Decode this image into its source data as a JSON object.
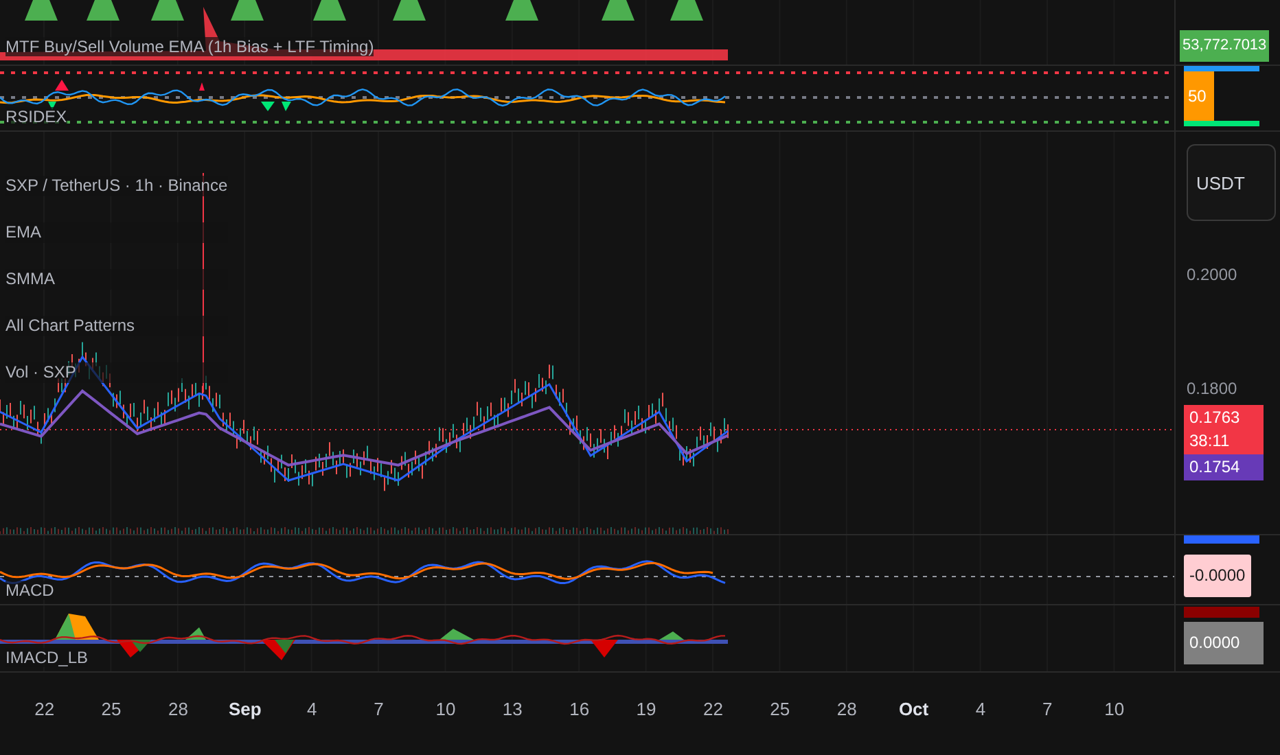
{
  "panes": [
    {
      "kind": "volume",
      "label": "MTF Buy/Sell Volume EMA (1h Bias + LTF Timing)",
      "tags": [
        {
          "text": "53,772.7013",
          "color": "#4caf50"
        }
      ]
    },
    {
      "kind": "rsi",
      "label": "RSIDEX",
      "tags": [
        {
          "text": "50",
          "color": "#ff9800"
        }
      ]
    },
    {
      "kind": "price",
      "legend": [
        "SXP / TetherUS · 1h · Binance",
        "EMA",
        "SMMA",
        "All Chart Patterns",
        "Vol · SXP"
      ],
      "currency_button": "USDT",
      "ticks": [
        "0.2000",
        "0.1800"
      ],
      "tags": [
        {
          "text": "0.1763",
          "sub": "38:11",
          "color": "#f23645"
        },
        {
          "text": "0.1754",
          "color": "#673ab7"
        }
      ]
    },
    {
      "kind": "macd",
      "label": "MACD",
      "tags": [
        {
          "text": "-0.0000",
          "color": "#ffcdd2"
        }
      ]
    },
    {
      "kind": "imacd",
      "label": "IMACD_LB",
      "tags": [
        {
          "text": "0.0000",
          "color": "#808080"
        }
      ]
    }
  ],
  "time_axis": [
    {
      "label": "22",
      "kind": "day"
    },
    {
      "label": "25",
      "kind": "day"
    },
    {
      "label": "28",
      "kind": "day"
    },
    {
      "label": "Sep",
      "kind": "month"
    },
    {
      "label": "4",
      "kind": "day"
    },
    {
      "label": "7",
      "kind": "day"
    },
    {
      "label": "10",
      "kind": "day"
    },
    {
      "label": "13",
      "kind": "day"
    },
    {
      "label": "16",
      "kind": "day"
    },
    {
      "label": "19",
      "kind": "day"
    },
    {
      "label": "22",
      "kind": "day"
    },
    {
      "label": "25",
      "kind": "day"
    },
    {
      "label": "28",
      "kind": "day"
    },
    {
      "label": "Oct",
      "kind": "month"
    },
    {
      "label": "4",
      "kind": "day"
    },
    {
      "label": "7",
      "kind": "day"
    },
    {
      "label": "10",
      "kind": "day"
    }
  ]
}
